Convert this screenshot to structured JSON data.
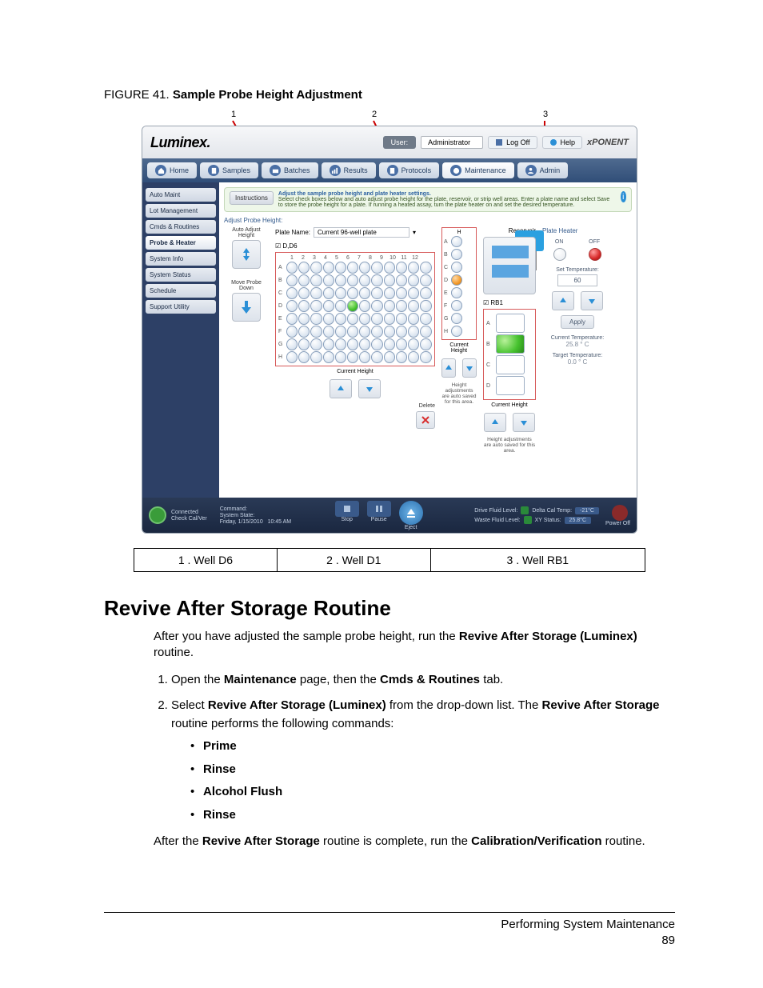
{
  "figure": {
    "prefix": "FIGURE 41.",
    "title": "Sample Probe Height Adjustment",
    "annots": [
      "1",
      "2",
      "3"
    ]
  },
  "app": {
    "logo": "Luminex.",
    "brand": "xPONENT",
    "user_label": "User:",
    "user_value": "Administrator",
    "logoff": "Log Off",
    "help": "Help",
    "nav": [
      "Home",
      "Samples",
      "Batches",
      "Results",
      "Protocols",
      "Maintenance",
      "Admin"
    ],
    "nav_sel": 5,
    "sidebar": [
      "Auto Maint",
      "Lot Management",
      "Cmds & Routines",
      "Probe & Heater",
      "System Info",
      "System Status",
      "Schedule",
      "Support Utility"
    ],
    "sidebar_sel": 3,
    "instr_btn": "Instructions",
    "instr_title": "Adjust the sample probe height and plate heater settings.",
    "instr_body": "Select check boxes below and auto adjust probe height for the plate, reservoir, or strip well areas. Enter a plate name and select Save to store the probe height for a plate. If running a heated assay, turn the plate heater on and set the desired temperature.",
    "section": "Adjust Probe Height:",
    "act1": "Auto Adjust Height",
    "act2": "Move Probe Down",
    "plate_name_lbl": "Plate Name:",
    "plate_name_val": "Current 96-well plate",
    "chk1": "D,D6",
    "chk2": "RB1",
    "cols": [
      "1",
      "2",
      "3",
      "4",
      "5",
      "6",
      "7",
      "8",
      "9",
      "10",
      "11",
      "12"
    ],
    "rows": [
      "A",
      "B",
      "C",
      "D",
      "E",
      "F",
      "G",
      "H"
    ],
    "mini_hdr": "H",
    "mini_rows": [
      "A",
      "B",
      "C",
      "D",
      "E",
      "F",
      "G",
      "H"
    ],
    "res_lbl": "Reservoir",
    "res_rows": [
      "A",
      "B",
      "C",
      "D"
    ],
    "curh": "Current Height",
    "delete": "Delete",
    "autosave": "Height adjustments are auto saved for this area.",
    "heater": {
      "title": "Plate Heater",
      "on": "ON",
      "off": "OFF",
      "set": "Set Temperature:",
      "set_val": "60",
      "apply": "Apply",
      "cur": "Current Temperature:",
      "cur_val": "25.8 ° C",
      "tgt": "Target Temperature:",
      "tgt_val": "0.0 ° C"
    },
    "footer": {
      "connected": "Connected",
      "check": "Check Cal/Ver",
      "cmd": "Command:",
      "state": "System State:",
      "date": "Friday, 1/15/2010",
      "time": "10:45 AM",
      "stop": "Stop",
      "pause": "Pause",
      "eject": "Eject",
      "drive": "Drive Fluid Level:",
      "waste": "Waste Fluid Level:",
      "delta": "Delta Cal Temp:",
      "delta_v": "-21°C",
      "xy": "XY Status:",
      "xy_v": "25.8°C",
      "power": "Power Off"
    }
  },
  "legend": [
    "1 . Well D6",
    "2 . Well D1",
    "3 . Well RB1"
  ],
  "h2": "Revive After Storage Routine",
  "p1_a": "After you have adjusted the sample probe height, run the ",
  "p1_b": "Revive After Storage (Luminex)",
  "p1_c": " routine.",
  "s1_a": "Open the ",
  "s1_b": "Maintenance",
  "s1_c": " page, then the ",
  "s1_d": "Cmds & Routines",
  "s1_e": " tab.",
  "s2_a": "Select ",
  "s2_b": "Revive After Storage (Luminex)",
  "s2_c": " from the drop-down list. The ",
  "s2_d": "Revive After Storage",
  "s2_e": " routine performs the following commands:",
  "cmds": [
    "Prime",
    "Rinse",
    "Alcohol Flush",
    "Rinse"
  ],
  "p2_a": "After the ",
  "p2_b": "Revive After Storage",
  "p2_c": " routine is complete, run the ",
  "p2_d": "Calibration/Verification",
  "p2_e": " routine.",
  "foot1": "Performing System Maintenance",
  "foot2": "89"
}
